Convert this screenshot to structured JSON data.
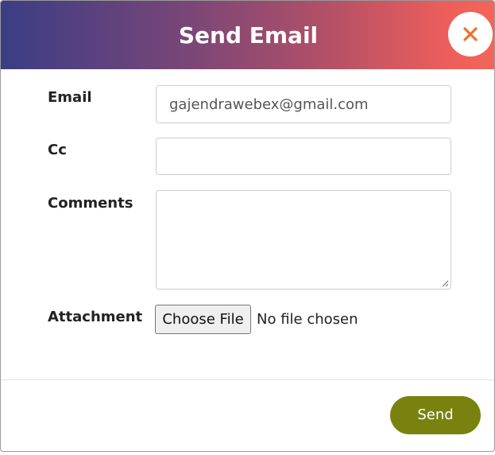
{
  "modal": {
    "title": "Send Email",
    "close_icon": "close-icon",
    "accent_color": "#f46558"
  },
  "form": {
    "email": {
      "label": "Email",
      "value": "gajendrawebex@gmail.com"
    },
    "cc": {
      "label": "Cc",
      "value": ""
    },
    "comments": {
      "label": "Comments",
      "value": ""
    },
    "attachment": {
      "label": "Attachment",
      "button_label": "Choose File",
      "status": "No file chosen"
    }
  },
  "footer": {
    "send_label": "Send",
    "send_color": "#7a820f"
  }
}
